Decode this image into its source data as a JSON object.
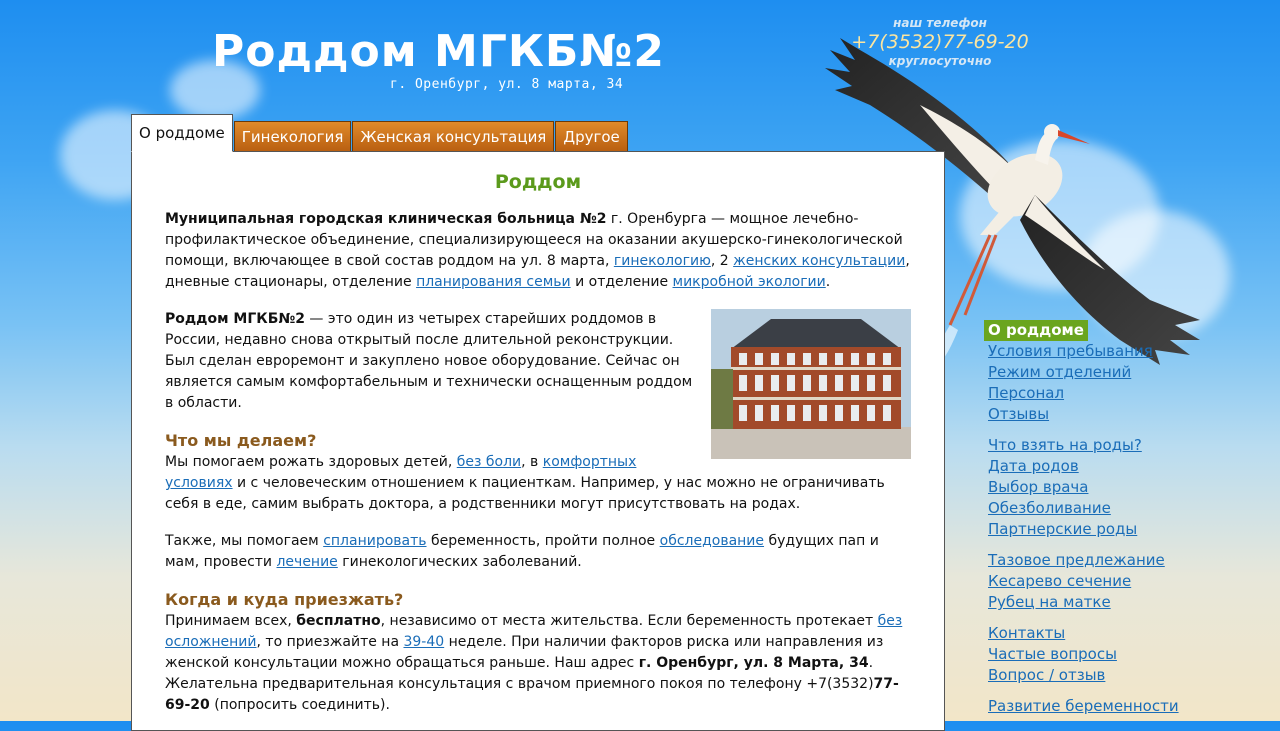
{
  "header": {
    "title": "Роддом МГКБ№2",
    "address": "г. Оренбург, ул. 8 марта, 34",
    "phone_caption": "наш телефон",
    "phone_number": "+7(3532)77-69-20",
    "phone_sub": "круглосуточно"
  },
  "tabs": [
    {
      "label": "О роддоме",
      "active": true
    },
    {
      "label": "Гинекология"
    },
    {
      "label": "Женская консультация"
    },
    {
      "label": "Другое"
    }
  ],
  "content": {
    "heading": "Роддом",
    "p1": {
      "bold": "Муниципальная городская клиническая больница №2",
      "t1": " г. Оренбурга — мощное лечебно-профилактическое объединение, специализирующееся на оказании акушерско-гинекологической помощи, включающее в свой состав роддом на ул. 8 марта, ",
      "link1": "гинекологию",
      "t2": ", 2 ",
      "link2": "женских консультации",
      "t3": ", дневные стационары, отделение ",
      "link3": "планирования семьи",
      "t4": " и отделение ",
      "link4": "микробной экологии",
      "t5": "."
    },
    "p2": {
      "bold": "Роддом МГКБ№2",
      "text": " — это один из четырех старейших роддомов в России, недавно снова открытый после длительной реконструкции. Был сделан евроремонт и закуплено новое оборудование. Сейчас он является самым комфортабельным и технически оснащенным роддом в области."
    },
    "h_what": "Что мы делаем?",
    "p3": {
      "t1": "Мы помогаем рожать здоровых детей, ",
      "link1": "без боли",
      "t2": ", в ",
      "link2": "комфортных условиях",
      "t3": " и с человеческим отношением к пациенткам. Например, у нас можно не ограничивать себя в еде, самим выбрать доктора, а родственники могут присутствовать на родах."
    },
    "p4": {
      "t1": "Также, мы помогаем ",
      "link1": "спланировать",
      "t2": " беременность, пройти полное ",
      "link2": "обследование",
      "t3": " будущих пап и мам, провести ",
      "link3": "лечение",
      "t4": " гинекологических заболеваний."
    },
    "h_when": "Когда и куда приезжать?",
    "p5": {
      "t1": "Принимаем всех, ",
      "bold1": "бесплатно",
      "t2": ", независимо от места жительства. Если беременность протекает ",
      "link1": "без осложнений",
      "t3": ", то приезжайте на ",
      "link2": "39-40",
      "t4": " неделе. При наличии факторов риска или направления из женской консультации можно обращаться раньше. Наш адрес ",
      "bold2": "г. Оренбург, ул. 8 Марта, 34",
      "t5": ". Желательна предварительная консультация с врачом приемного покоя по телефону +7(3532)",
      "bold3": "77-69-20",
      "t6": " (попросить соединить)."
    }
  },
  "sidebar": {
    "groups": [
      [
        "О роддоме",
        "Условия пребывания",
        "Режим отделений",
        "Персонал",
        "Отзывы"
      ],
      [
        "Что взять на роды?",
        "Дата родов",
        "Выбор врача",
        "Обезболивание",
        "Партнерские роды"
      ],
      [
        "Тазовое предлежание",
        "Кесарево сечение",
        "Рубец на матке"
      ],
      [
        "Контакты",
        "Частые вопросы",
        "Вопрос / отзыв"
      ],
      [
        "Развитие беременности"
      ]
    ],
    "active": "О роддоме"
  },
  "colors": {
    "accent_green": "#5b9a1c",
    "tab_orange": "#c86e18",
    "link": "#1a6db8",
    "subheading_brown": "#8a5a1e"
  },
  "icons": [
    "stork-illustration",
    "hospital-building-photo"
  ]
}
